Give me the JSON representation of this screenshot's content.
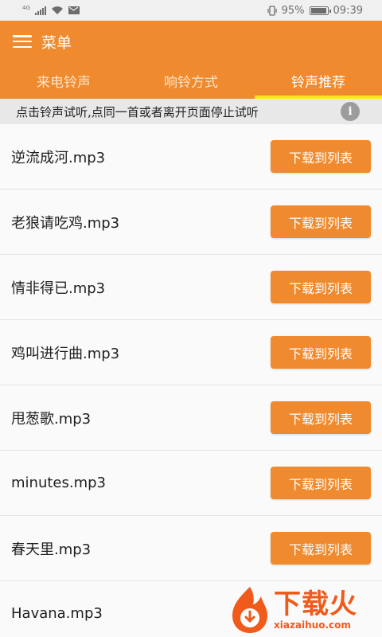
{
  "status_bar": {
    "network_badge": "4G",
    "battery_percent": "95%",
    "battery_level": 0.95,
    "time": "09:39"
  },
  "app_bar": {
    "title": "菜单",
    "icon": "menu-icon"
  },
  "tabs": [
    {
      "label": "来电铃声",
      "active": false
    },
    {
      "label": "响铃方式",
      "active": false
    },
    {
      "label": "铃声推荐",
      "active": true
    }
  ],
  "hint": {
    "text": "点击铃声试听,点同一首或者离开页面停止试听",
    "icon": "info-icon"
  },
  "list": {
    "button_label": "下载到列表",
    "items": [
      {
        "title": "逆流成河.mp3"
      },
      {
        "title": "老狼请吃鸡.mp3"
      },
      {
        "title": "情非得已.mp3"
      },
      {
        "title": "鸡叫进行曲.mp3"
      },
      {
        "title": "甩葱歌.mp3"
      },
      {
        "title": "minutes.mp3"
      },
      {
        "title": "春天里.mp3"
      },
      {
        "title": "Havana.mp3"
      }
    ]
  },
  "watermark": {
    "brand_cn": "下载火",
    "brand_en": "xiazaihuo.com"
  },
  "colors": {
    "accent": "#ef8a2e",
    "tab_indicator": "#ffe81a",
    "hint_bg": "#e8e8e8"
  }
}
